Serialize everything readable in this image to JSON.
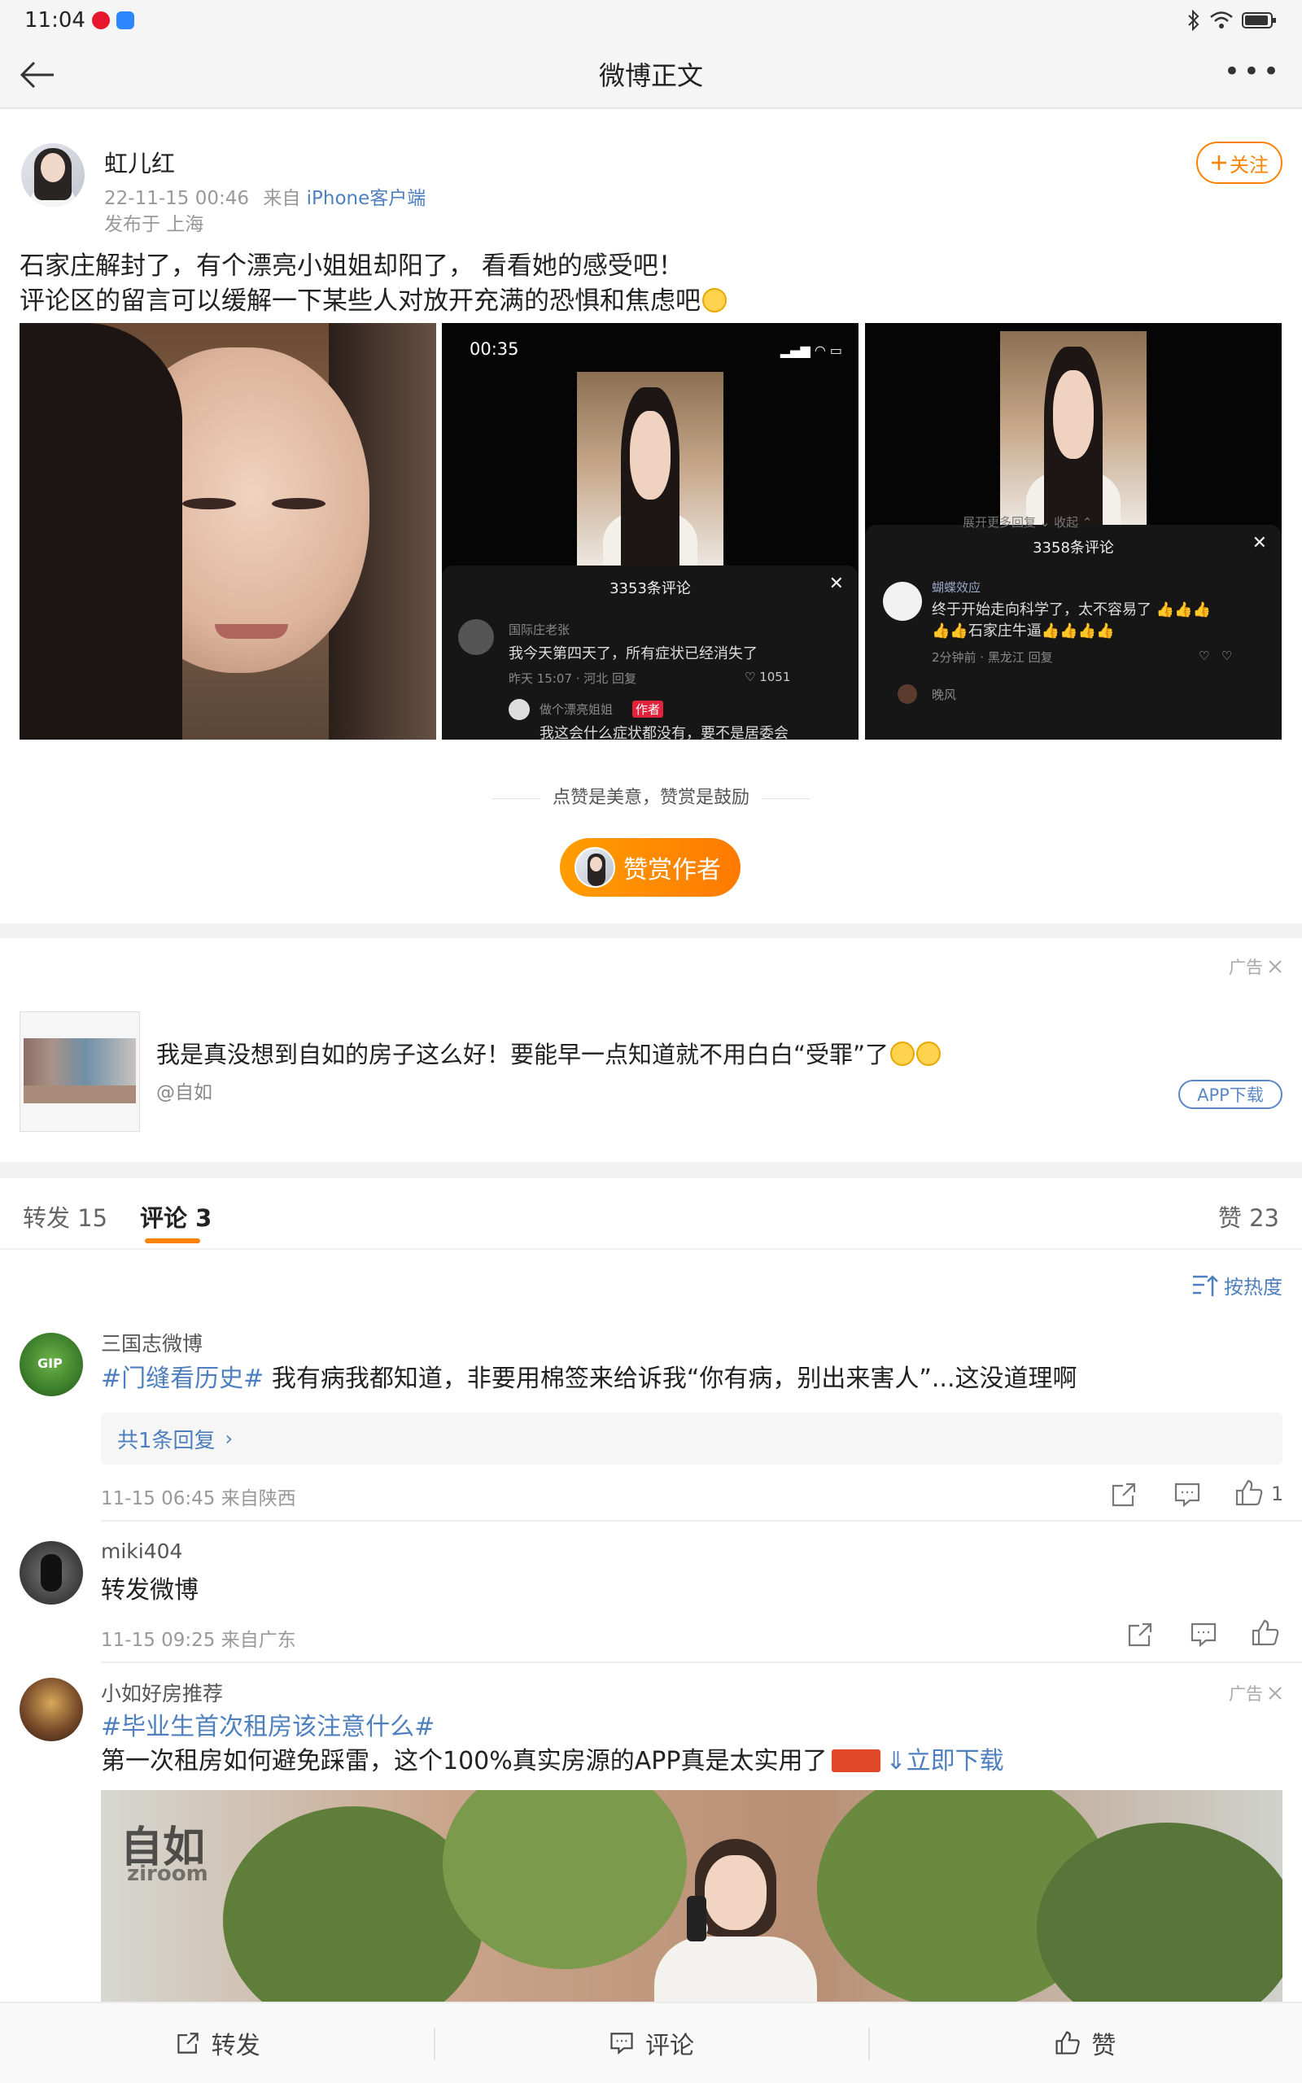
{
  "status_bar": {
    "time": "11:04"
  },
  "nav": {
    "title": "微博正文"
  },
  "post": {
    "author": "虹儿红",
    "time": "22-11-15 00:46",
    "from_label": "来自",
    "source": "iPhone客户端",
    "location": "发布于 上海",
    "follow_label": "关注",
    "text_line1": "石家庄解封了，有个漂亮小姐姐却阳了， 看看她的感受吧！",
    "text_line2": "评论区的留言可以缓解一下某些人对放开充满的恐惧和焦虑吧",
    "images": [
      {
        "kind": "selfie"
      },
      {
        "video_time": "00:35",
        "panel_title": "3353条评论",
        "commenter": "国际庄老张",
        "comment": "我今天第四天了，所有症状已经消失了",
        "meta": "昨天 15:07 · 河北   回复",
        "likes": "1051",
        "author_reply": "做个漂亮姐姐",
        "author_tag": "作者",
        "reply_snippet": "我这会什么症状都没有，要不是居委会"
      },
      {
        "top_snippet": "展开更多回复 ⌄     收起 ⌃",
        "panel_title": "3358条评论",
        "commenter": "蝴蝶效应",
        "comment_line1": "终于开始走向科学了，太不容易了",
        "comment_line2": "石家庄牛逼",
        "meta": "2分钟前 · 黑龙江   回复",
        "next_commenter": "晚风"
      }
    ]
  },
  "reward": {
    "tip": "点赞是美意，赞赏是鼓励",
    "button": "赞赏作者"
  },
  "ad": {
    "tag": "广告",
    "title": "我是真没想到自如的房子这么好！要能早一点知道就不用白白“受罪”了",
    "account": "@自如",
    "cta": "APP下载"
  },
  "tabs": {
    "repost": "转发 15",
    "comment": "评论 3",
    "like": "赞 23"
  },
  "sort_label": "按热度",
  "comments": [
    {
      "name": "三国志微博",
      "topic": "#门缝看历史#",
      "text": " 我有病我都知道，非要用棉签来给诉我“你有病，别出来害人”...这没道理啊",
      "reply_summary": "共1条回复",
      "time": "11-15 06:45 来自陕西",
      "likes": "1"
    },
    {
      "name": "miki404",
      "text": "转发微博",
      "time": "11-15 09:25 来自广东"
    },
    {
      "name": "小如好房推荐",
      "ad_tag": "广告",
      "topic": "#毕业生首次租房该注意什么#",
      "text": "第一次租房如何避免踩雷，这个100%真实房源的APP真是太实用了",
      "download": "立即下载",
      "brand": "自如",
      "brand_en": "ziroom"
    }
  ],
  "bottom_bar": {
    "repost": "转发",
    "comment": "评论",
    "like": "赞"
  },
  "colors": {
    "accent": "#ff8200",
    "link": "#4e7fbf"
  }
}
